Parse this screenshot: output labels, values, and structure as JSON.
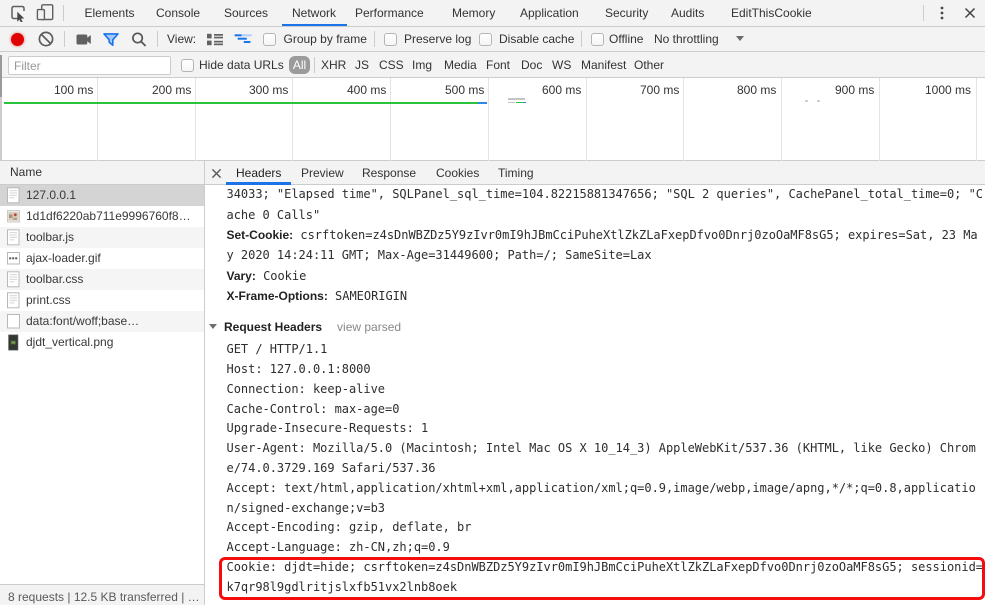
{
  "colors": {
    "accent_blue": "#1a73e8",
    "record_red": "#e00000",
    "waterfall_green": "#2cc33c",
    "waterfall_blue": "#2f87ee",
    "waterfall_gray": "#c3c3c3",
    "toolbar_bg": "#f3f3f3",
    "highlight_red": "#f50d0d",
    "selected_row_bg": "#d4d4d4"
  },
  "main_toolbar": {
    "tabs": [
      "Elements",
      "Console",
      "Sources",
      "Network",
      "Performance",
      "Memory",
      "Application",
      "Security",
      "Audits",
      "EditThisCookie"
    ],
    "selected_tab": "Network"
  },
  "action_bar": {
    "view_label": "View:",
    "group_by_frame": "Group by frame",
    "preserve_log": "Preserve log",
    "disable_cache": "Disable cache",
    "offline": "Offline",
    "throttling": "No throttling"
  },
  "filter_bar": {
    "placeholder": "Filter",
    "hide_data_urls": "Hide data URLs",
    "types": [
      "All",
      "XHR",
      "JS",
      "CSS",
      "Img",
      "Media",
      "Font",
      "Doc",
      "WS",
      "Manifest",
      "Other"
    ],
    "selected_type": "All"
  },
  "overview": {
    "tick_labels": [
      "100 ms",
      "200 ms",
      "300 ms",
      "400 ms",
      "500 ms",
      "600 ms",
      "700 ms",
      "800 ms",
      "900 ms",
      "1000 ms"
    ]
  },
  "requests": {
    "header": "Name",
    "rows": [
      {
        "name": "127.0.0.1",
        "icon": "document-icon",
        "selected": true
      },
      {
        "name": "1d1df6220ab711e9996760f8…",
        "icon": "image-preview-icon"
      },
      {
        "name": "toolbar.js",
        "icon": "document-icon"
      },
      {
        "name": "ajax-loader.gif",
        "icon": "image-dots-icon"
      },
      {
        "name": "toolbar.css",
        "icon": "document-icon"
      },
      {
        "name": "print.css",
        "icon": "document-icon"
      },
      {
        "name": "data:font/woff;base…",
        "icon": "blank-icon"
      },
      {
        "name": "djdt_vertical.png",
        "icon": "image-dark-icon"
      }
    ]
  },
  "summary": "8 requests | 12.5 KB transferred | …",
  "details": {
    "tabs": [
      "Headers",
      "Preview",
      "Response",
      "Cookies",
      "Timing"
    ],
    "selected_tab": "Headers",
    "response_lines": [
      {
        "name": "",
        "value": "34033; \"Elapsed time\", SQLPanel_sql_time=104.82215881347656; \"SQL 2 queries\", CachePanel_total_time=0; \"C"
      },
      {
        "name": "",
        "value": "ache 0 Calls\""
      },
      {
        "name": "Set-Cookie:",
        "value": " csrftoken=z4sDnWBZDz5Y9zIvr0mI9hJBmCciPuheXtlZkZLaFxepDfvo0Dnrj0zoOaMF8sG5; expires=Sat, 23 Ma"
      },
      {
        "name": "",
        "value": "y 2020 14:24:11 GMT; Max-Age=31449600; Path=/; SameSite=Lax"
      },
      {
        "name": "Vary:",
        "value": " Cookie"
      },
      {
        "name": "X-Frame-Options:",
        "value": " SAMEORIGIN"
      }
    ],
    "request_section": {
      "title": "Request Headers",
      "action": "view parsed"
    },
    "request_lines": [
      "GET / HTTP/1.1",
      "Host: 127.0.0.1:8000",
      "Connection: keep-alive",
      "Cache-Control: max-age=0",
      "Upgrade-Insecure-Requests: 1",
      "User-Agent: Mozilla/5.0 (Macintosh; Intel Mac OS X 10_14_3) AppleWebKit/537.36 (KHTML, like Gecko) Chrom",
      "e/74.0.3729.169 Safari/537.36",
      "Accept: text/html,application/xhtml+xml,application/xml;q=0.9,image/webp,image/apng,*/*;q=0.8,applicatio",
      "n/signed-exchange;v=b3",
      "Accept-Encoding: gzip, deflate, br",
      "Accept-Language: zh-CN,zh;q=0.9",
      "Cookie: djdt=hide; csrftoken=z4sDnWBZDz5Y9zIvr0mI9hJBmCciPuheXtlZkZLaFxepDfvo0Dnrj0zoOaMF8sG5; sessionid=",
      "k7qr98l9gdlritjslxfb51vx2lnb8oek"
    ]
  }
}
